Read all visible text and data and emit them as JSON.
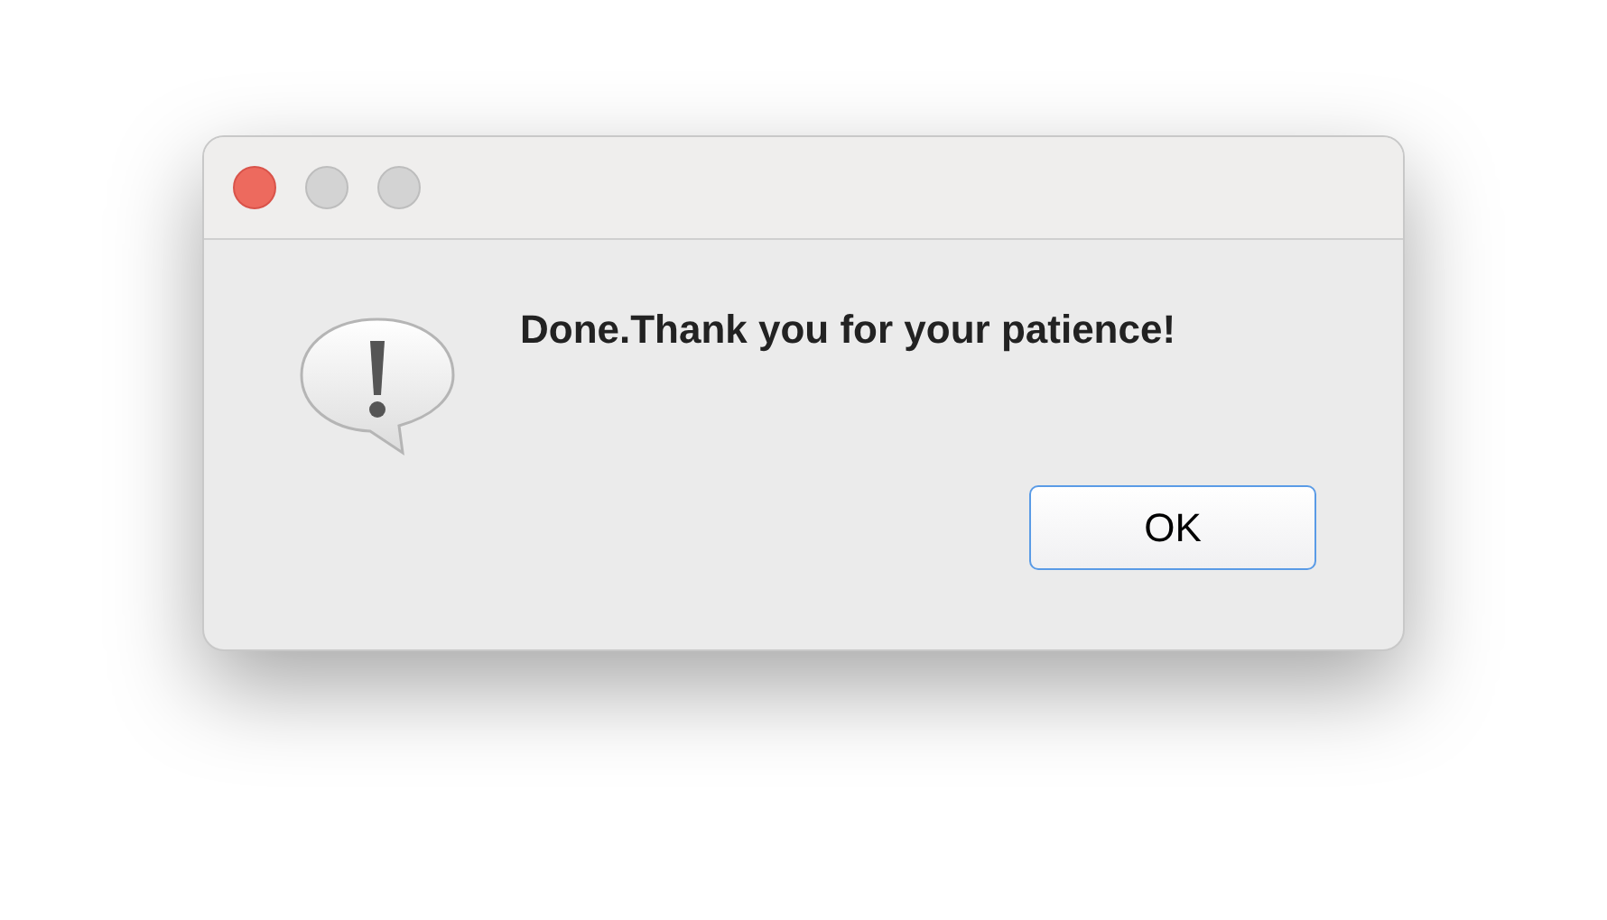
{
  "window": {
    "controls": [
      {
        "kind": "close",
        "disabled": false
      },
      {
        "kind": "minimize",
        "disabled": true
      },
      {
        "kind": "zoom",
        "disabled": true
      }
    ]
  },
  "message": "Done.Thank you for your patience!",
  "buttons": [
    {
      "label": "OK",
      "default": true
    }
  ]
}
